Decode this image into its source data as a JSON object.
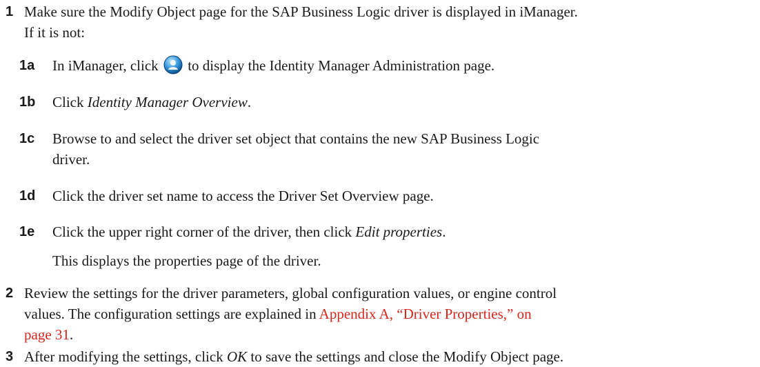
{
  "steps": [
    {
      "num": "1",
      "line1": "Make sure the Modify Object page for the SAP Business Logic driver is displayed in iManager.",
      "line2": "If it is not:",
      "substeps": [
        {
          "num": "1a",
          "before": "In iManager, click",
          "icon": "identity-manager-icon",
          "after": "to display the Identity Manager Administration page."
        },
        {
          "num": "1b",
          "before": "Click",
          "italic": "Identity Manager Overview",
          "after": "."
        },
        {
          "num": "1c",
          "line1": "Browse to and select the driver set object that contains the new SAP Business Logic",
          "line2": "driver."
        },
        {
          "num": "1d",
          "text": "Click the driver set name to access the Driver Set Overview page."
        },
        {
          "num": "1e",
          "before": "Click the upper right corner of the driver, then click",
          "italic": "Edit properties",
          "after": ".",
          "note": "This displays the properties page of the driver."
        }
      ]
    },
    {
      "num": "2",
      "line1": "Review the settings for the driver parameters, global configuration values, or engine control",
      "line2_before": "values. The configuration settings are explained in",
      "link1": "Appendix A, “Driver Properties,” on",
      "link2": "page 31",
      "line3_after": "."
    },
    {
      "num": "3",
      "before": "After modifying the settings, click",
      "italic": "OK",
      "after": "to save the settings and close the Modify Object page."
    }
  ],
  "colors": {
    "link": "#d9261c",
    "text": "#1a1a1a"
  }
}
